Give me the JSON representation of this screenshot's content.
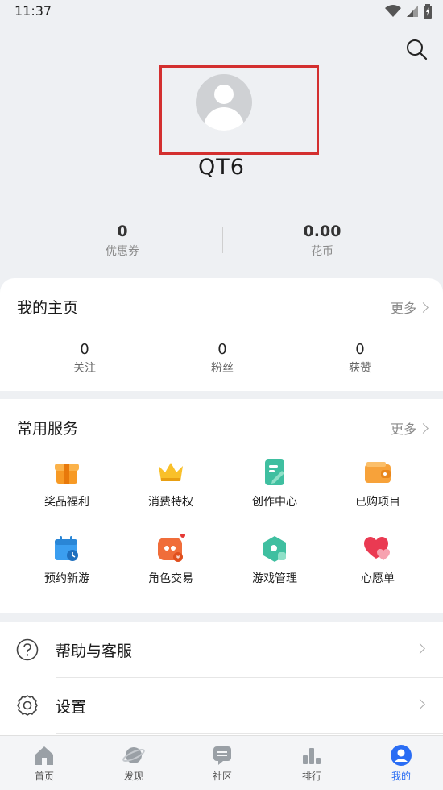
{
  "status": {
    "time": "11:37"
  },
  "profile": {
    "username": "QT6"
  },
  "wallet": [
    {
      "value": "0",
      "label": "优惠券"
    },
    {
      "value": "0.00",
      "label": "花币"
    }
  ],
  "my_home": {
    "title": "我的主页",
    "more": "更多",
    "stats": [
      {
        "value": "0",
        "label": "关注"
      },
      {
        "value": "0",
        "label": "粉丝"
      },
      {
        "value": "0",
        "label": "获赞"
      }
    ]
  },
  "services": {
    "title": "常用服务",
    "more": "更多",
    "items": [
      {
        "label": "奖品福利",
        "icon": "gift-icon"
      },
      {
        "label": "消费特权",
        "icon": "crown-icon"
      },
      {
        "label": "创作中心",
        "icon": "creation-icon"
      },
      {
        "label": "已购项目",
        "icon": "wallet-icon"
      },
      {
        "label": "预约新游",
        "icon": "calendar-icon"
      },
      {
        "label": "角色交易",
        "icon": "trade-icon"
      },
      {
        "label": "游戏管理",
        "icon": "game-manage-icon"
      },
      {
        "label": "心愿单",
        "icon": "heart-icon"
      }
    ]
  },
  "help": [
    {
      "label": "帮助与客服",
      "icon": "help-icon"
    },
    {
      "label": "设置",
      "icon": "settings-icon"
    }
  ],
  "tabs": [
    {
      "label": "首页",
      "icon": "home-icon"
    },
    {
      "label": "发现",
      "icon": "planet-icon"
    },
    {
      "label": "社区",
      "icon": "chat-icon"
    },
    {
      "label": "排行",
      "icon": "ranking-icon"
    },
    {
      "label": "我的",
      "icon": "profile-icon",
      "active": true
    }
  ],
  "colors": {
    "accent": "#2a6df4",
    "highlight_box": "#d32f2f"
  }
}
